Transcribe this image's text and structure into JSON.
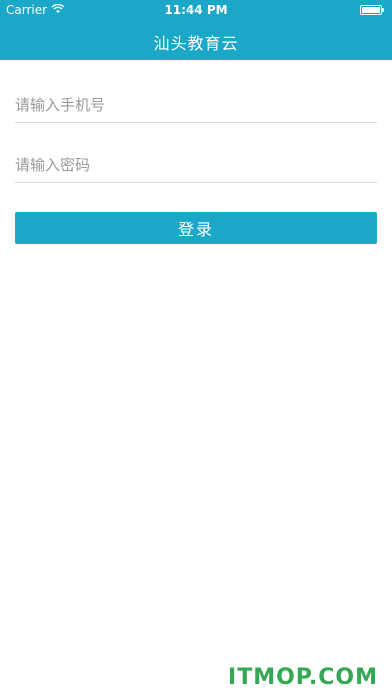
{
  "status_bar": {
    "carrier": "Carrier",
    "time": "11:44 PM",
    "wifi_icon": "wifi-icon",
    "battery_icon": "battery-icon"
  },
  "header": {
    "title": "汕头教育云"
  },
  "login_form": {
    "phone_placeholder": "请输入手机号",
    "password_placeholder": "请输入密码",
    "login_label": "登录"
  },
  "watermark": {
    "text": "ITMOP.COM"
  },
  "colors": {
    "accent": "#1ba8c8",
    "background": "#ffffff",
    "placeholder": "#9a9a9a",
    "watermark": "#34a853"
  }
}
